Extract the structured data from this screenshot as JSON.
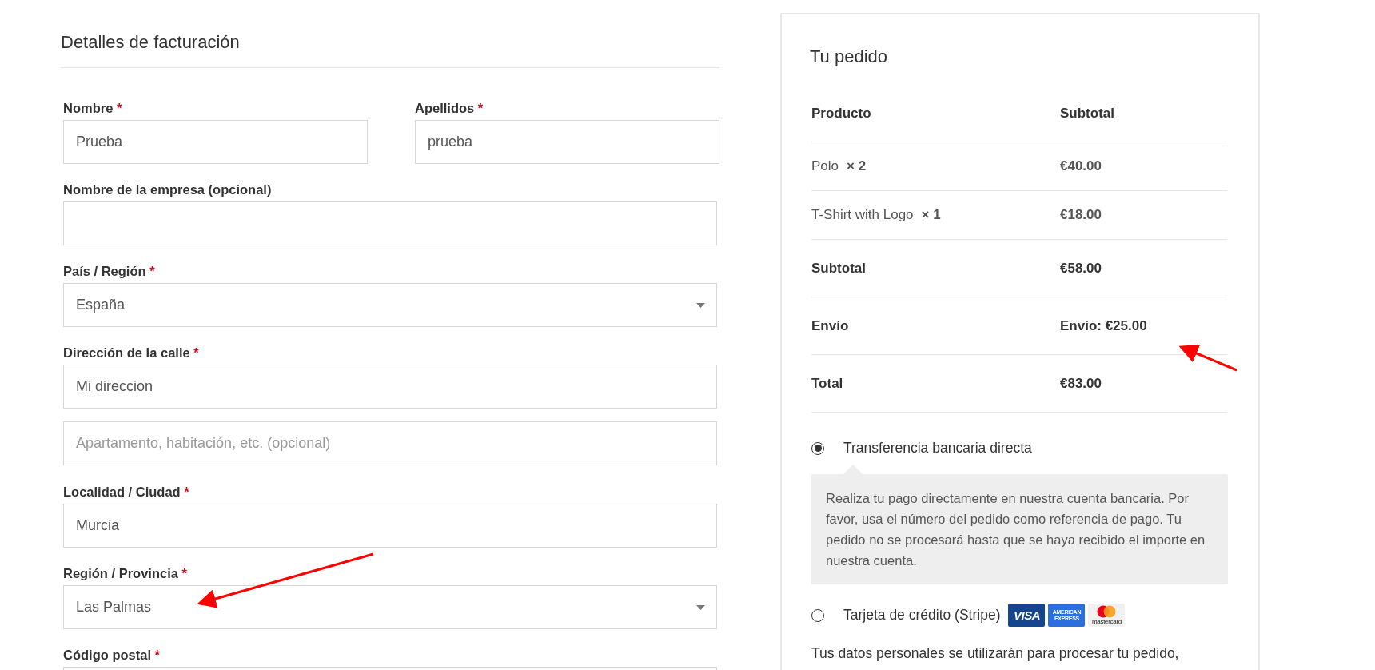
{
  "billing": {
    "title": "Detalles de facturación",
    "fields": [
      {
        "kind": "text",
        "label": "Nombre",
        "required_mark": "*",
        "value": "Prueba",
        "half": true
      },
      {
        "kind": "text",
        "label": "Apellidos",
        "required_mark": "*",
        "value": "prueba",
        "half": true
      },
      {
        "kind": "text",
        "label": "Nombre de la empresa (opcional)"
      },
      {
        "kind": "select",
        "label": "País / Región",
        "required_mark": "*",
        "value": "España"
      },
      {
        "kind": "text",
        "label": "Dirección de la calle",
        "required_mark": "*",
        "value": "Mi direccion"
      },
      {
        "kind": "text",
        "placeholder": "Apartamento, habitación, etc. (opcional)"
      },
      {
        "kind": "text",
        "label": "Localidad / Ciudad",
        "required_mark": "*",
        "value": "Murcia"
      },
      {
        "kind": "select",
        "label": "Región / Provincia",
        "required_mark": "*",
        "value": "Las Palmas"
      },
      {
        "kind": "text",
        "label": "Código postal",
        "required_mark": "*"
      }
    ]
  },
  "order": {
    "title": "Tu pedido",
    "columns": [
      "Producto",
      "Subtotal"
    ],
    "rows": [
      {
        "kind": "item",
        "name": "Polo",
        "qty": "× 2",
        "amount": "€40.00"
      },
      {
        "kind": "item",
        "name": "T-Shirt with Logo",
        "qty": "× 1",
        "amount": "€18.00"
      },
      {
        "kind": "total",
        "name": "Subtotal",
        "amount": "€58.00"
      },
      {
        "kind": "total",
        "name": "Envío",
        "amount": "Envio: €25.00"
      },
      {
        "kind": "total",
        "name": "Total",
        "amount": "€83.00"
      }
    ],
    "payment_methods": [
      {
        "label": "Transferencia bancaria directa",
        "selected": true,
        "description": "Realiza tu pago directamente en nuestra cuenta bancaria. Por favor, usa el número del pedido como referencia de pago. Tu pedido no se procesará hasta que se haya recibido el importe en nuestra cuenta."
      },
      {
        "label": "Tarjeta de crédito (Stripe)",
        "selected": false,
        "cards": [
          {
            "kind": "visa",
            "text": "VISA"
          },
          {
            "kind": "amex",
            "text": "AMERICAN EXPRESS"
          },
          {
            "kind": "mastercard",
            "text": "mastercard"
          }
        ]
      }
    ],
    "privacy_text": "Tus datos personales se utilizarán para procesar tu pedido,"
  }
}
